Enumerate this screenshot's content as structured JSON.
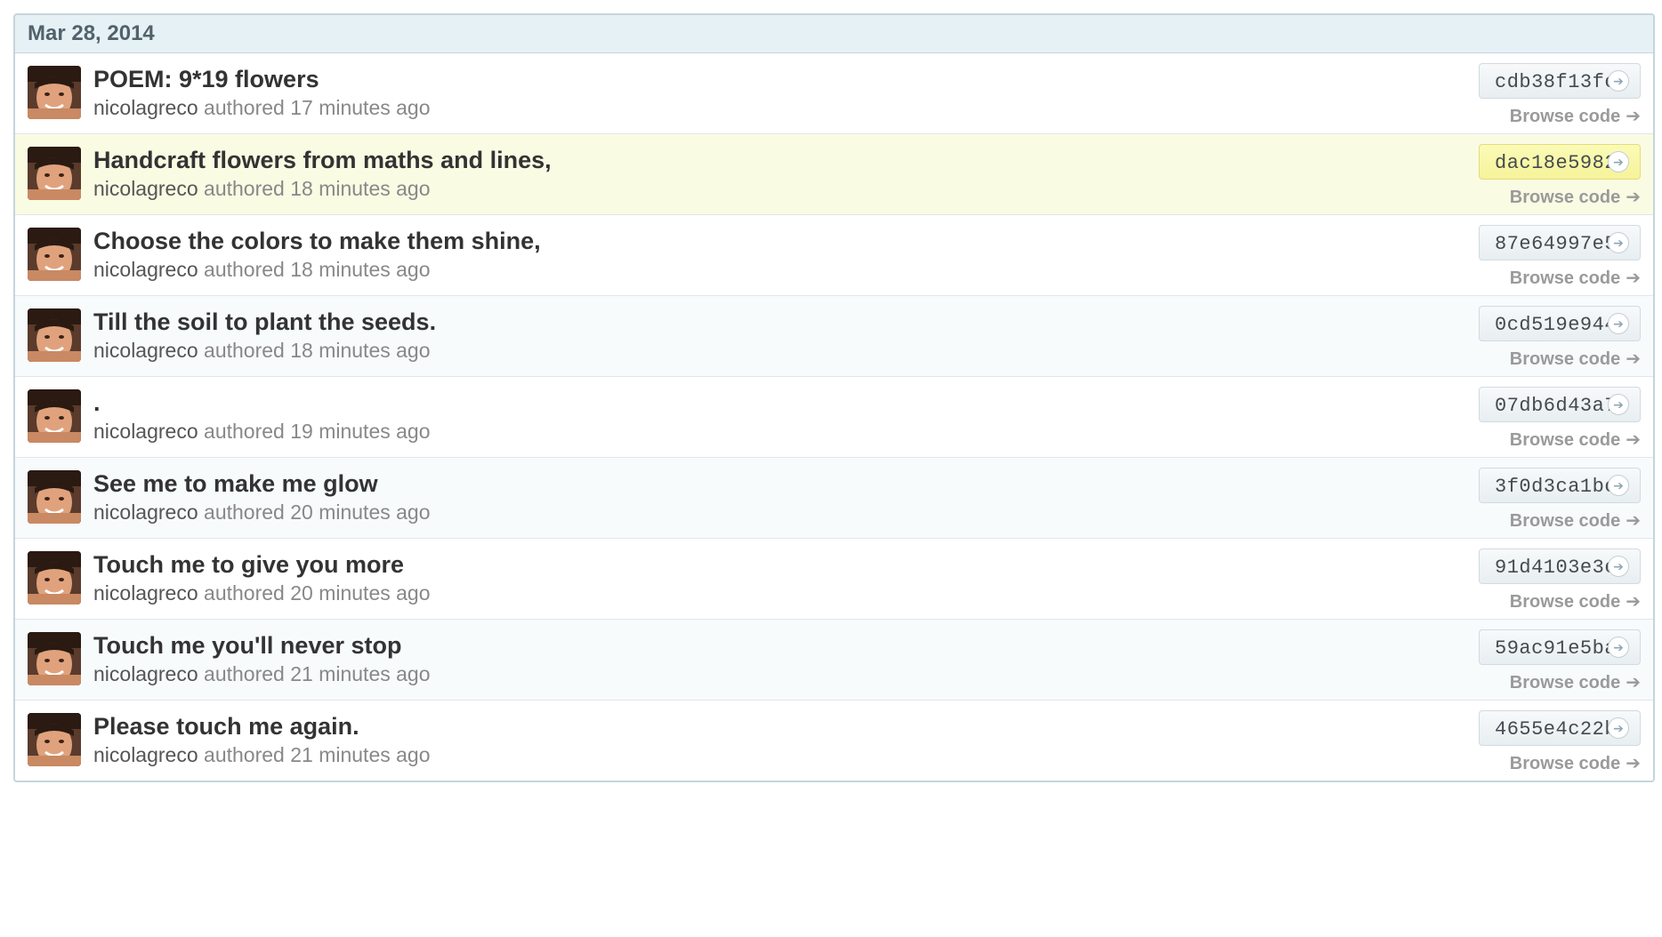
{
  "group": {
    "date": "Mar 28, 2014"
  },
  "browse_label": "Browse code",
  "commits": [
    {
      "message": "POEM: 9*19 flowers",
      "author": "nicolagreco",
      "action": "authored",
      "time": "17 minutes ago",
      "sha": "cdb38f13fc"
    },
    {
      "message": "Handcraft flowers from maths and lines,",
      "author": "nicolagreco",
      "action": "authored",
      "time": "18 minutes ago",
      "sha": "dac18e5982"
    },
    {
      "message": "Choose the colors to make them shine,",
      "author": "nicolagreco",
      "action": "authored",
      "time": "18 minutes ago",
      "sha": "87e64997e5"
    },
    {
      "message": "Till the soil to plant the seeds.",
      "author": "nicolagreco",
      "action": "authored",
      "time": "18 minutes ago",
      "sha": "0cd519e944"
    },
    {
      "message": ".",
      "author": "nicolagreco",
      "action": "authored",
      "time": "19 minutes ago",
      "sha": "07db6d43a7"
    },
    {
      "message": "See me to make me glow",
      "author": "nicolagreco",
      "action": "authored",
      "time": "20 minutes ago",
      "sha": "3f0d3ca1bc"
    },
    {
      "message": "Touch me to give you more",
      "author": "nicolagreco",
      "action": "authored",
      "time": "20 minutes ago",
      "sha": "91d4103e3e"
    },
    {
      "message": "Touch me you'll never stop",
      "author": "nicolagreco",
      "action": "authored",
      "time": "21 minutes ago",
      "sha": "59ac91e5ba"
    },
    {
      "message": "Please touch me again.",
      "author": "nicolagreco",
      "action": "authored",
      "time": "21 minutes ago",
      "sha": "4655e4c22b"
    }
  ]
}
